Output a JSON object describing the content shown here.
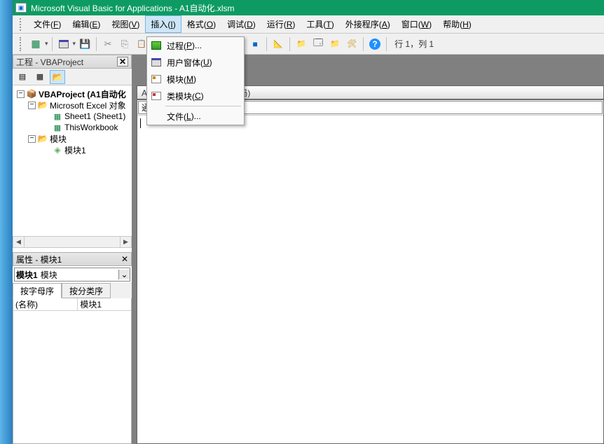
{
  "title_bar": {
    "text": "Microsoft Visual Basic for Applications - A1自动化.xlsm"
  },
  "menu_bar": {
    "file": {
      "label": "文件(",
      "accel": "F",
      "suffix": ")"
    },
    "edit": {
      "label": "编辑(",
      "accel": "E",
      "suffix": ")"
    },
    "view": {
      "label": "视图(",
      "accel": "V",
      "suffix": ")"
    },
    "insert": {
      "label": "插入(",
      "accel": "I",
      "suffix": ")"
    },
    "format": {
      "label": "格式(",
      "accel": "O",
      "suffix": ")"
    },
    "debug": {
      "label": "调试(",
      "accel": "D",
      "suffix": ")"
    },
    "run": {
      "label": "运行(",
      "accel": "R",
      "suffix": ")"
    },
    "tools": {
      "label": "工具(",
      "accel": "T",
      "suffix": ")"
    },
    "addins": {
      "label": "外接程序(",
      "accel": "A",
      "suffix": ")"
    },
    "window": {
      "label": "窗口(",
      "accel": "W",
      "suffix": ")"
    },
    "help": {
      "label": "帮助(",
      "accel": "H",
      "suffix": ")"
    }
  },
  "toolbar": {
    "position_text": "行 1，列 1"
  },
  "insert_menu": {
    "procedure": {
      "label": "过程(",
      "accel": "P",
      "suffix": ")..."
    },
    "userform": {
      "label": "用户窗体(",
      "accel": "U",
      "suffix": ")"
    },
    "module": {
      "label": "模块(",
      "accel": "M",
      "suffix": ")"
    },
    "classmod": {
      "label": "类模块(",
      "accel": "C",
      "suffix": ")"
    },
    "file": {
      "label": "文件(",
      "accel": "L",
      "suffix": ")..."
    }
  },
  "project_pane": {
    "title": "工程 - VBAProject",
    "root": "VBAProject (A1自动化",
    "excel_objects": "Microsoft Excel 对象",
    "sheet1": "Sheet1 (Sheet1)",
    "thisworkbook": "ThisWorkbook",
    "modules_folder": "模块",
    "module1": "模块1"
  },
  "properties_pane": {
    "title": "属性 - 模块1",
    "object_name": "模块1",
    "object_type": "模块",
    "tab_alpha": "按字母序",
    "tab_cat": "按分类序",
    "prop_name_label": "(名称)",
    "prop_name_value": "模块1"
  },
  "code_window": {
    "title": "A1自动化.xlsm - 模块1 (代码)",
    "combo_left": "通用）"
  }
}
